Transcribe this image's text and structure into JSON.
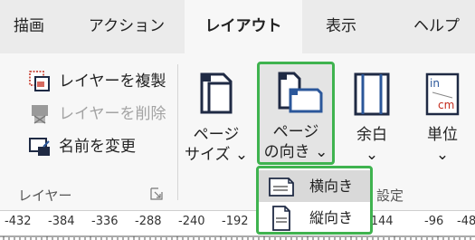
{
  "tabs": {
    "draw": "描画",
    "action": "アクション",
    "layout": "レイアウト",
    "view": "表示",
    "help": "ヘルプ"
  },
  "layer_group": {
    "duplicate": "レイヤーを複製",
    "delete": "レイヤーを削除",
    "rename": "名前を変更",
    "label": "レイヤー"
  },
  "page_setup": {
    "page_size_line1": "ページ",
    "page_size_line2": "サイズ ⌄",
    "orientation_line1": "ページ",
    "orientation_line2": "の向き ⌄",
    "margins_line1": "余白",
    "margins_line2": "⌄",
    "units_line1": "単位",
    "units_line2": "⌄",
    "units_icon_top": "in",
    "units_icon_bottom": "cm",
    "label_partial": "設定"
  },
  "orientation_menu": {
    "landscape": "横向き",
    "portrait": "縦向き"
  },
  "ruler": {
    "ticks": [
      "-432",
      "-384",
      "-336",
      "-288",
      "-240",
      "-192",
      "-144",
      "-96",
      "-48"
    ]
  },
  "colors": {
    "accent_green": "#3fb34f",
    "icon_dark": "#1f2a44",
    "icon_blue": "#2b579a",
    "icon_red": "#c42b1c"
  }
}
